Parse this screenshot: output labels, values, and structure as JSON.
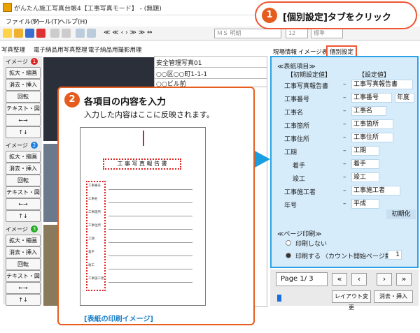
{
  "window": {
    "title": "がんたん施工写真台帳4【工事写真モード】 - (無題)"
  },
  "menu": [
    "ファイル(F)",
    "ツール(T)",
    "ヘルプ(H)"
  ],
  "toolbar": {
    "nav": "≪ ≪ ‹ › ≫ ≫ ⇔",
    "font": "ＭＳ 明朝",
    "size": "12",
    "size_unit": "標準"
  },
  "tabs": [
    "写真整理",
    "電子納品用写真整理",
    "電子納品用撮影用理"
  ],
  "left_groups": [
    {
      "label": "イメージ",
      "num": "1",
      "buttons": [
        "拡大・縮画",
        "消去・挿入",
        "回転",
        "テキスト・図",
        "←→",
        "↑↓"
      ]
    },
    {
      "label": "イメージ",
      "num": "2",
      "buttons": [
        "拡大・縮画",
        "消去・挿入",
        "回転",
        "テキスト・図",
        "←→",
        "↑↓"
      ]
    },
    {
      "label": "イメージ",
      "num": "3",
      "buttons": [
        "拡大・縮画",
        "消去・挿入",
        "回転",
        "テキスト・図",
        "←→",
        "↑↓"
      ]
    }
  ],
  "doc_lines": [
    "安全管理写真01",
    "○○区○○町1-1-1",
    "○○ビル前"
  ],
  "callout1": {
    "num": "1",
    "text": "[個別設定]タブをクリック"
  },
  "right_tabs": [
    "現場情報",
    "イメージ表示",
    "個別設定"
  ],
  "right_panel": {
    "section": "≪表紙項目≫",
    "col_initial": "【初期設定値】",
    "col_setting": "【設定値】",
    "rows": [
      {
        "label": "工事写真報告書",
        "value": "工事写真報告書"
      },
      {
        "label": "工事番号",
        "value": "工事番号",
        "extra": "年度"
      },
      {
        "label": "工事名",
        "value": "工事名"
      },
      {
        "label": "工事箇所",
        "value": "工事箇所"
      },
      {
        "label": "工事住所",
        "value": "工事住所"
      },
      {
        "label": "工期",
        "value": "工期"
      },
      {
        "label": "着手",
        "value": "着手"
      },
      {
        "label": "竣工",
        "value": "竣工"
      },
      {
        "label": "工事施工者",
        "value": "工事施工者"
      },
      {
        "label": "年号",
        "value": "平成"
      }
    ],
    "reset": "初期化",
    "print_section": "≪ページ印刷≫",
    "print_no": "印刷しない",
    "print_yes": "印刷する",
    "print_count_label": "〈カウント開始ページ数〉：",
    "print_count": "1"
  },
  "pager": {
    "page": "Page 1/ 3",
    "layout": "レイアウト変更",
    "insert": "消去・挿入"
  },
  "callout2": {
    "num": "2",
    "title": "各項目の内容を入力",
    "sub": "入力した内容はここに反映されます。"
  },
  "preview": {
    "title": "工 事 写 真 報 告 書",
    "lines": [
      "工事番号",
      "工事名",
      "工事箇所",
      "工事住所",
      "工期",
      "着手",
      "竣工",
      "工事施工者"
    ],
    "caption": "[表紙の印刷イメージ]"
  }
}
